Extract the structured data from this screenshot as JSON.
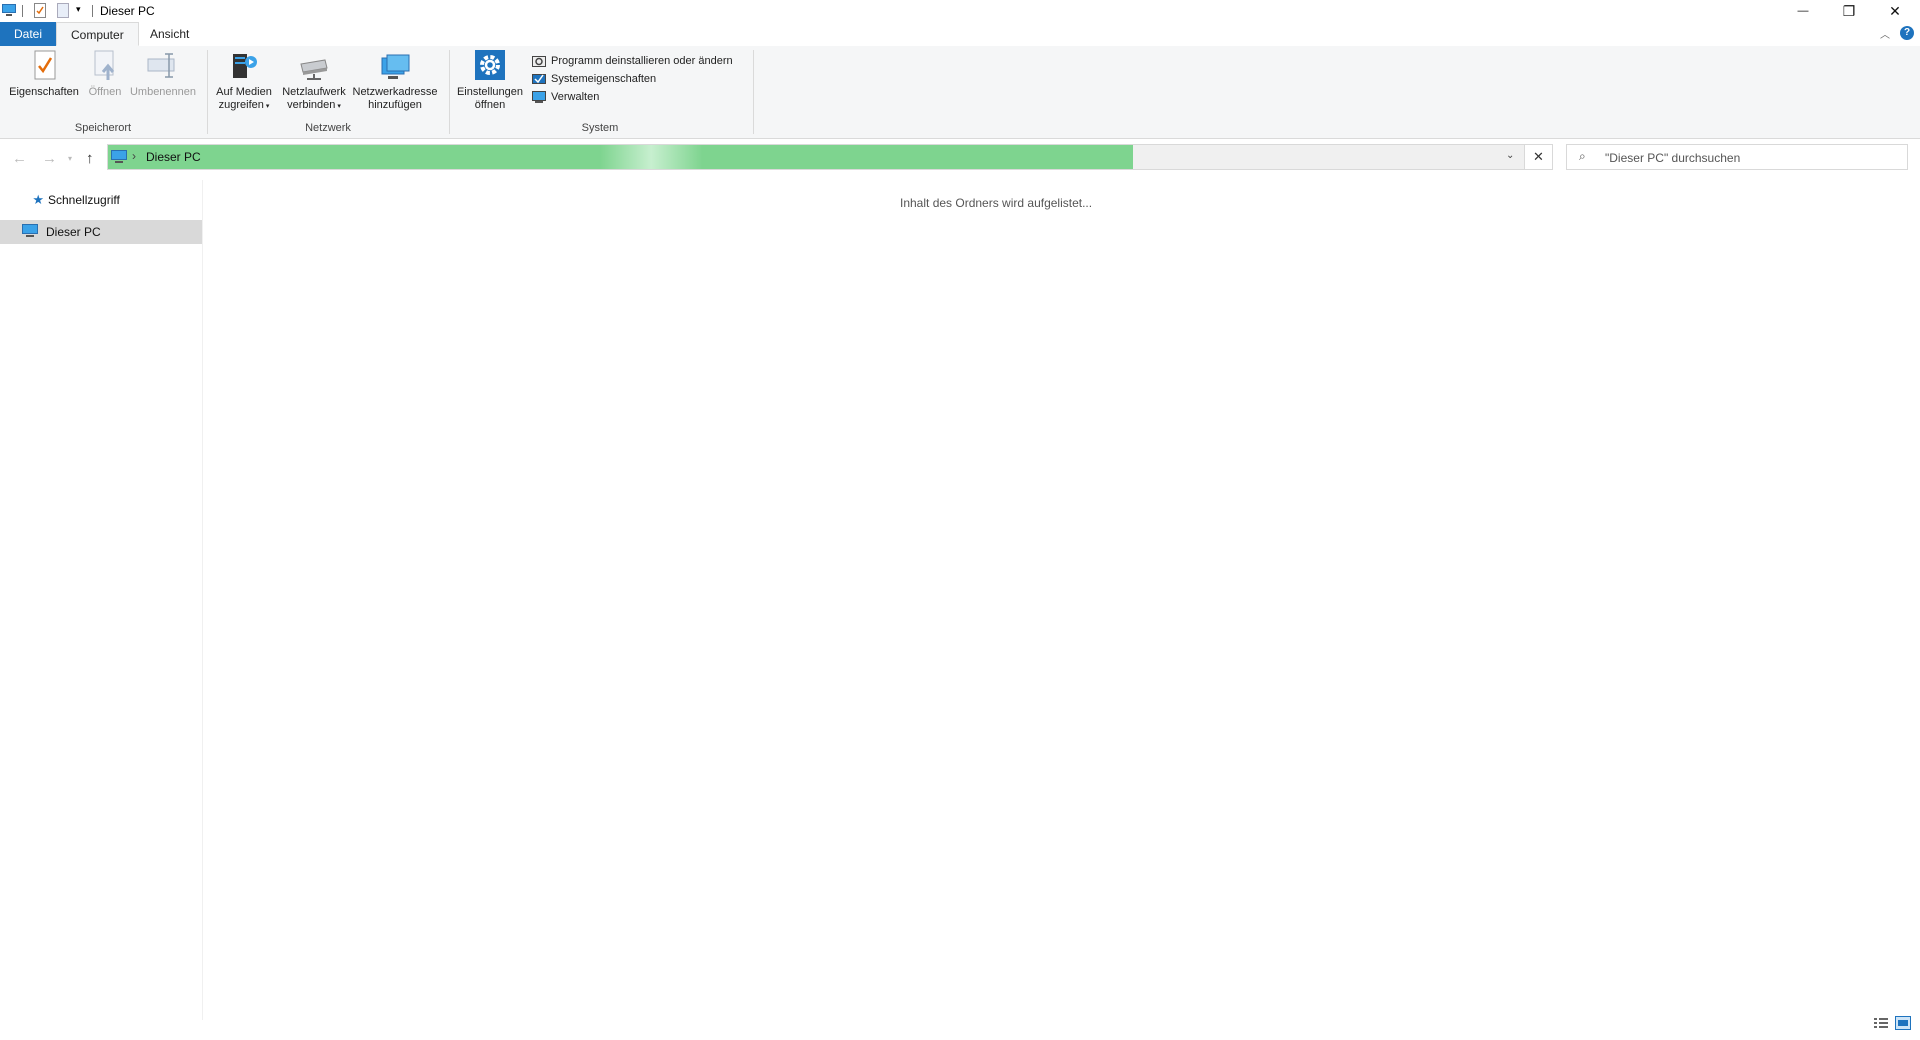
{
  "window": {
    "title": "Dieser PC",
    "controls": {
      "minimize": "—",
      "restore": "❐",
      "close": "✕"
    }
  },
  "tabs": [
    {
      "label": "Datei"
    },
    {
      "label": "Computer"
    },
    {
      "label": "Ansicht"
    }
  ],
  "ribbon": {
    "groups": {
      "speicherort": {
        "label": "Speicherort",
        "eigenschaften": "Eigenschaften",
        "oeffnen": "Öffnen",
        "umbenennen": "Umbenennen"
      },
      "netzwerk": {
        "label": "Netzwerk",
        "medien_line1": "Auf Medien",
        "medien_line2": "zugreifen",
        "laufwerk_line1": "Netzlaufwerk",
        "laufwerk_line2": "verbinden",
        "adresse_line1": "Netzwerkadresse",
        "adresse_line2": "hinzufügen"
      },
      "system": {
        "label": "System",
        "einstellungen_line1": "Einstellungen",
        "einstellungen_line2": "öffnen",
        "programm": "Programm deinstallieren oder ändern",
        "systemeigenschaften": "Systemeigenschaften",
        "verwalten": "Verwalten"
      }
    }
  },
  "address": {
    "separator": "›",
    "location": "Dieser PC",
    "loading_progress": 0.71
  },
  "search": {
    "placeholder": "\"Dieser PC\" durchsuchen"
  },
  "navpane": {
    "items": [
      {
        "label": "Schnellzugriff"
      },
      {
        "label": "Dieser PC"
      }
    ]
  },
  "content": {
    "status": "Inhalt des Ordners wird aufgelistet..."
  },
  "colors": {
    "accent": "#1e73be",
    "progress": "#7ed48f",
    "selected": "#d9d9d9"
  }
}
